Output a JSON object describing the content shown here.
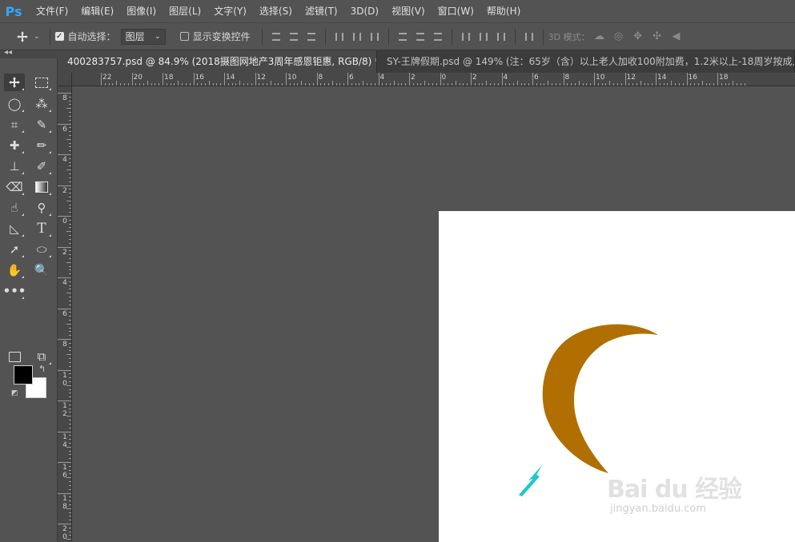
{
  "app": {
    "logo": "Ps"
  },
  "menu": [
    "文件(F)",
    "编辑(E)",
    "图像(I)",
    "图层(L)",
    "文字(Y)",
    "选择(S)",
    "滤镜(T)",
    "3D(D)",
    "视图(V)",
    "窗口(W)",
    "帮助(H)"
  ],
  "options": {
    "auto_select_label": "自动选择：",
    "auto_select_checked": true,
    "auto_select_target": "图层",
    "show_transform_label": "显示变换控件",
    "show_transform_checked": false,
    "mode_3d_label": "3D 模式："
  },
  "panel": {
    "collapse_label": "◂◂"
  },
  "tabs": [
    {
      "title": "400283757.psd @ 84.9% (2018摄图网地产3周年感恩钜惠, RGB/8) *",
      "close": "×"
    },
    {
      "title": "SY-王牌假期.psd @ 149% (注：65岁（含）以上老人加收100附加费，1.2米以上-18周岁按成人"
    }
  ],
  "rulers": {
    "horizontal": [
      "22",
      "20",
      "18",
      "16",
      "14",
      "12",
      "10",
      "8",
      "6",
      "4",
      "2",
      "0",
      "2",
      "4",
      "6",
      "8",
      "10",
      "12",
      "14",
      "16",
      "18"
    ],
    "vertical": [
      "8",
      "6",
      "4",
      "2",
      "0",
      "2",
      "4",
      "6",
      "8",
      "10",
      "12",
      "14",
      "16",
      "18",
      "20"
    ]
  },
  "canvas": {
    "background": "#ffffff",
    "crescent_color": "#b06f00",
    "arrow_color": "#1fc7cf"
  },
  "watermark": {
    "main": "Bai du 经验",
    "sub": "jingyan.baidu.com"
  }
}
